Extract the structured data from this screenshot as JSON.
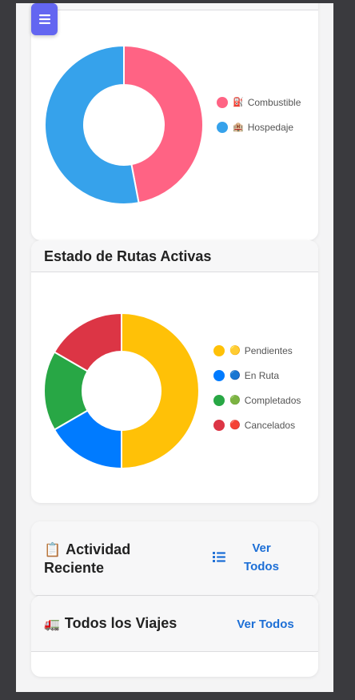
{
  "menu": {
    "icon": "hamburger-icon"
  },
  "gastos_card": {
    "icon": ""
  },
  "rutas_card": {
    "title": "Estado de Rutas Activas"
  },
  "actividad_card": {
    "emoji": "📋",
    "title_line1": "Actividad",
    "title_line2": "Reciente",
    "icon": "list-icon",
    "link_line1": "Ver",
    "link_line2": "Todos"
  },
  "viajes_card": {
    "emoji": "🚛",
    "title": "Todos los Viajes",
    "link": "Ver Todos"
  },
  "chart_data": [
    {
      "type": "pie",
      "variant": "doughnut",
      "title": "",
      "legend_position": "right",
      "series": [
        {
          "name": "Combustible",
          "emoji": "⛽",
          "value": 47,
          "color": "#ff6384"
        },
        {
          "name": "Hospedaje",
          "emoji": "🏨",
          "value": 53,
          "color": "#36a2eb"
        }
      ]
    },
    {
      "type": "pie",
      "variant": "doughnut",
      "title": "Estado de Rutas Activas",
      "legend_position": "right",
      "series": [
        {
          "name": "Pendientes",
          "emoji": "🟡",
          "value": 3,
          "color": "#ffc107"
        },
        {
          "name": "En Ruta",
          "emoji": "🔵",
          "value": 1,
          "color": "#007bff"
        },
        {
          "name": "Completados",
          "emoji": "🟢",
          "value": 1,
          "color": "#28a745"
        },
        {
          "name": "Cancelados",
          "emoji": "🔴",
          "value": 1,
          "color": "#dc3545"
        }
      ]
    }
  ]
}
